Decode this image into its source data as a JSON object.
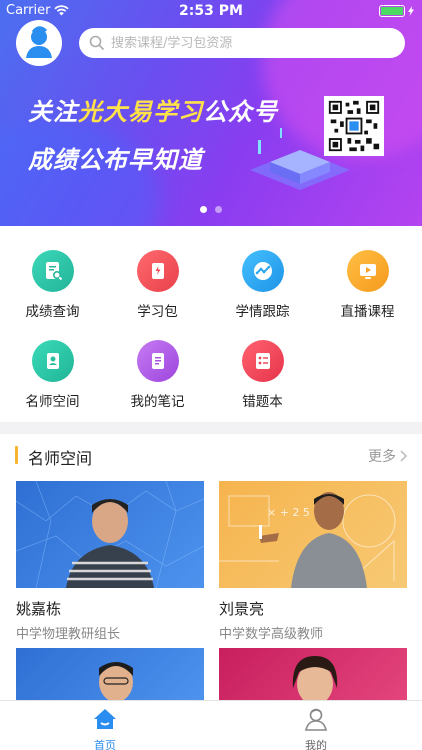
{
  "status": {
    "carrier": "Carrier",
    "time": "2:53 PM"
  },
  "search": {
    "placeholder": "搜索课程/学习包资源"
  },
  "banner": {
    "line1_prefix": "关注",
    "line1_highlight": "光大易学习",
    "line1_suffix": "公众号",
    "line2": "成绩公布早知道",
    "slides": 2,
    "active_slide": 1
  },
  "grid": {
    "items": [
      {
        "label": "成绩查询",
        "icon": "report-search-icon",
        "color": "#29c3a7"
      },
      {
        "label": "学习包",
        "icon": "study-pack-icon",
        "color": "#f2525a"
      },
      {
        "label": "学情跟踪",
        "icon": "trend-chart-icon",
        "color": "#2ba8ee"
      },
      {
        "label": "直播课程",
        "icon": "live-play-icon",
        "color": "#f8a52c"
      },
      {
        "label": "名师空间",
        "icon": "teacher-id-icon",
        "color": "#2fc9a8"
      },
      {
        "label": "我的笔记",
        "icon": "note-icon",
        "color": "#b15ee6"
      },
      {
        "label": "错题本",
        "icon": "wrong-list-icon",
        "color": "#f0465a"
      }
    ]
  },
  "section": {
    "title": "名师空间",
    "more": "更多"
  },
  "teachers": [
    {
      "name": "姚嘉栋",
      "role": "中学物理教研组长",
      "bg": "#3a7fd8"
    },
    {
      "name": "刘景亮",
      "role": "中学数学高级教师",
      "bg": "#f3b14a"
    },
    {
      "name": "",
      "role": "",
      "bg": "#3a7fd8"
    },
    {
      "name": "",
      "role": "",
      "bg": "#d8316e"
    }
  ],
  "tabs": [
    {
      "label": "首页",
      "icon": "home-icon",
      "active": true
    },
    {
      "label": "我的",
      "icon": "profile-icon",
      "active": false
    }
  ],
  "colors": {
    "accent": "#2a8df0",
    "section_bar": "#f5b52f"
  }
}
